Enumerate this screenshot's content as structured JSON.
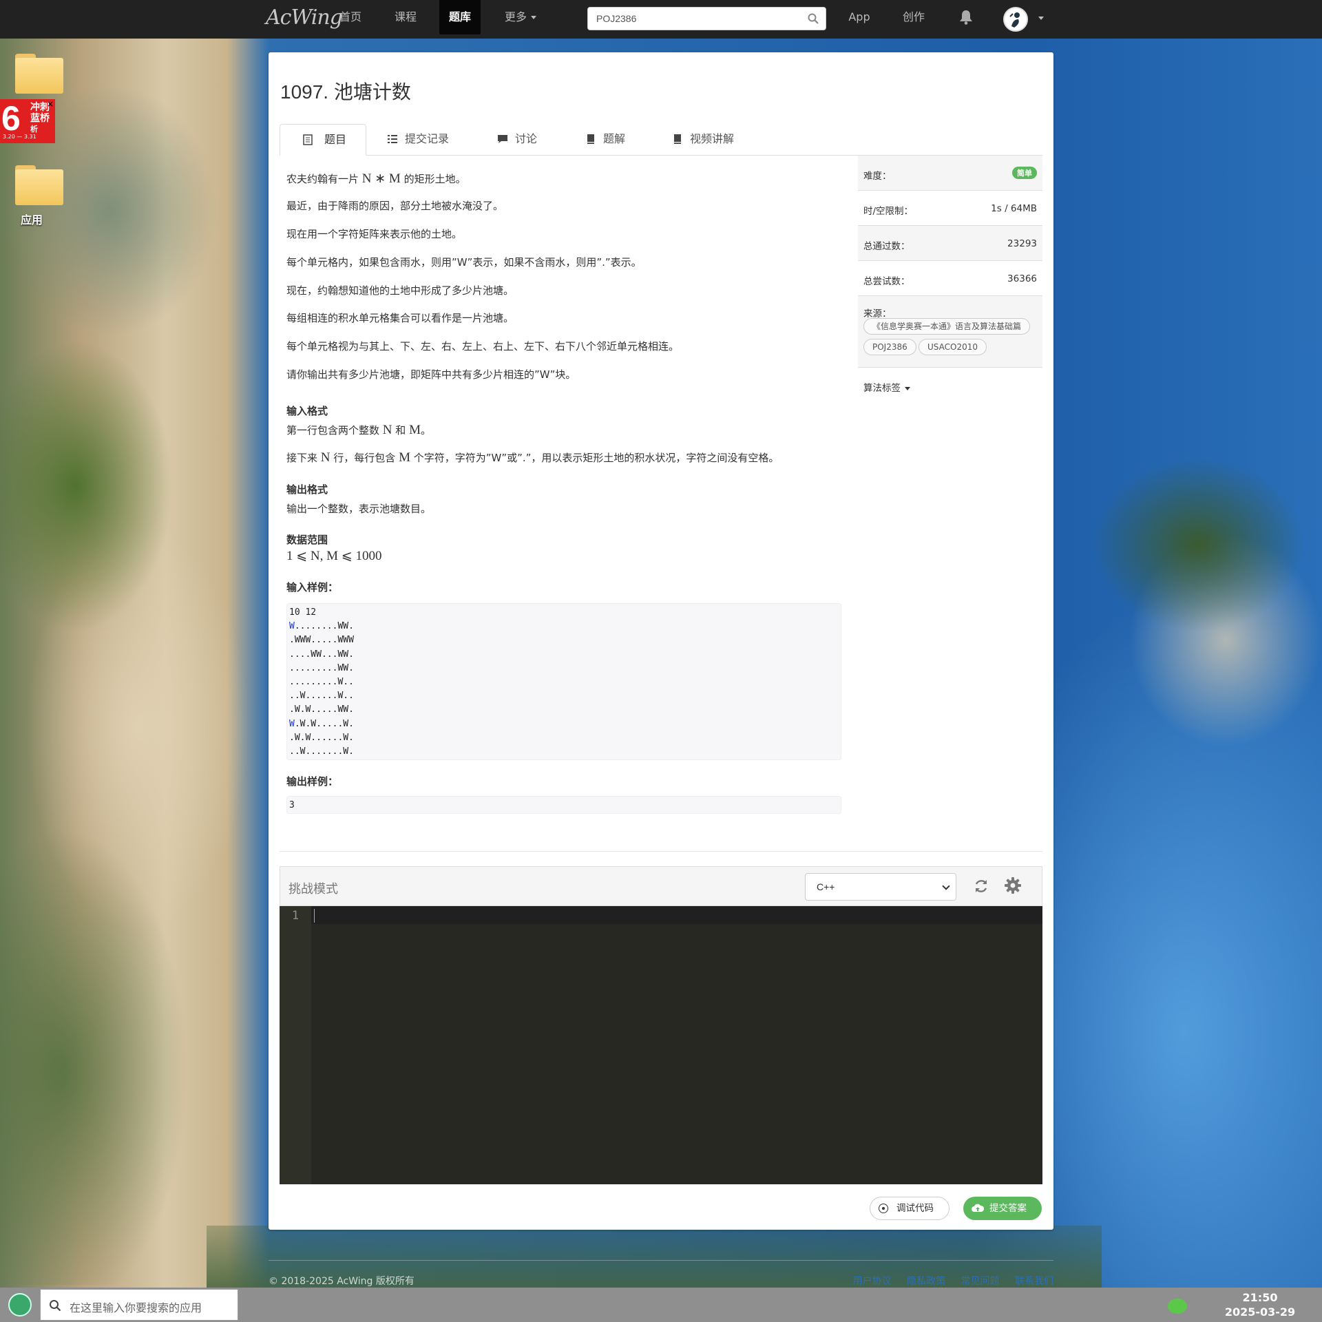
{
  "nav": {
    "logo": "AcWing",
    "items": [
      {
        "label": "首页"
      },
      {
        "label": "课程"
      },
      {
        "label": "题库"
      },
      {
        "label": "更多"
      }
    ],
    "search_value": "POJ2386",
    "app": "App",
    "create": "创作"
  },
  "desktop": {
    "apps_label": "应用",
    "promo": {
      "big": "6",
      "text": "冲刺蓝桥",
      "sub": "析",
      "dates": "3.20 — 3.31",
      "close": "×"
    }
  },
  "problem": {
    "title": "1097. 池塘计数",
    "tabs": [
      {
        "label": "题目"
      },
      {
        "label": "提交记录"
      },
      {
        "label": "讨论"
      },
      {
        "label": "题解"
      },
      {
        "label": "视频讲解"
      }
    ],
    "paragraphs": {
      "p1_pre": "农夫约翰有一片 ",
      "p1_math": "N ∗ M",
      "p1_post": " 的矩形土地。",
      "p2": "最近，由于降雨的原因，部分土地被水淹没了。",
      "p3": "现在用一个字符矩阵来表示他的土地。",
      "p4": "每个单元格内，如果包含雨水，则用”W”表示，如果不含雨水，则用”.”表示。",
      "p5": "现在，约翰想知道他的土地中形成了多少片池塘。",
      "p6": "每组相连的积水单元格集合可以看作是一片池塘。",
      "p7": "每个单元格视为与其上、下、左、右、左上、右上、左下、右下八个邻近单元格相连。",
      "p8": "请你输出共有多少片池塘，即矩阵中共有多少片相连的”W”块。"
    },
    "input_heading": "输入格式",
    "input_p1_pre": "第一行包含两个整数 ",
    "input_p1_math1": "N",
    "input_p1_mid": " 和 ",
    "input_p1_math2": "M",
    "input_p1_post": "。",
    "input_p2_pre": "接下来 ",
    "input_p2_math1": "N",
    "input_p2_mid": " 行，每行包含 ",
    "input_p2_math2": "M",
    "input_p2_post": " 个字符，字符为”W”或”.”，用以表示矩形土地的积水状况，字符之间没有空格。",
    "output_heading": "输出格式",
    "output_p": "输出一个整数，表示池塘数目。",
    "range_heading": "数据范围",
    "range_text": "1 ⩽ N, M ⩽ 1000",
    "sample_in_heading": "输入样例：",
    "sample_in_lines": [
      "10 12",
      "W........WW.",
      ".WWW.....WWW",
      "....WW...WW.",
      ".........WW.",
      ".........W..",
      "..W......W..",
      ".W.W.....WW.",
      "W.W.W.....W.",
      ".W.W......W.",
      "..W.......W."
    ],
    "sample_out_heading": "输出样例：",
    "sample_out": "3"
  },
  "sidebar": {
    "difficulty_label": "难度：",
    "difficulty_value": "简单",
    "limit_label": "时/空限制：",
    "limit_value": "1s / 64MB",
    "passed_label": "总通过数：",
    "passed_value": "23293",
    "tried_label": "总尝试数：",
    "tried_value": "36366",
    "source_label": "来源：",
    "sources": [
      "《信息学奥赛一本通》语言及算法基础篇",
      "POJ2386",
      "USACO2010"
    ],
    "tags_label": "算法标签"
  },
  "editor": {
    "mode_label": "挑战模式",
    "language": "C++",
    "line_number": "1",
    "debug_label": "调试代码",
    "submit_label": "提交答案"
  },
  "footer": {
    "copyright": "© 2018-2025 AcWing 版权所有",
    "links": [
      "用户协议",
      "隐私政策",
      "常见问题",
      "联系我们"
    ]
  },
  "taskbar": {
    "search_placeholder": "在这里输入你要搜索的应用",
    "time": "21:50",
    "date": "2025-03-29"
  }
}
